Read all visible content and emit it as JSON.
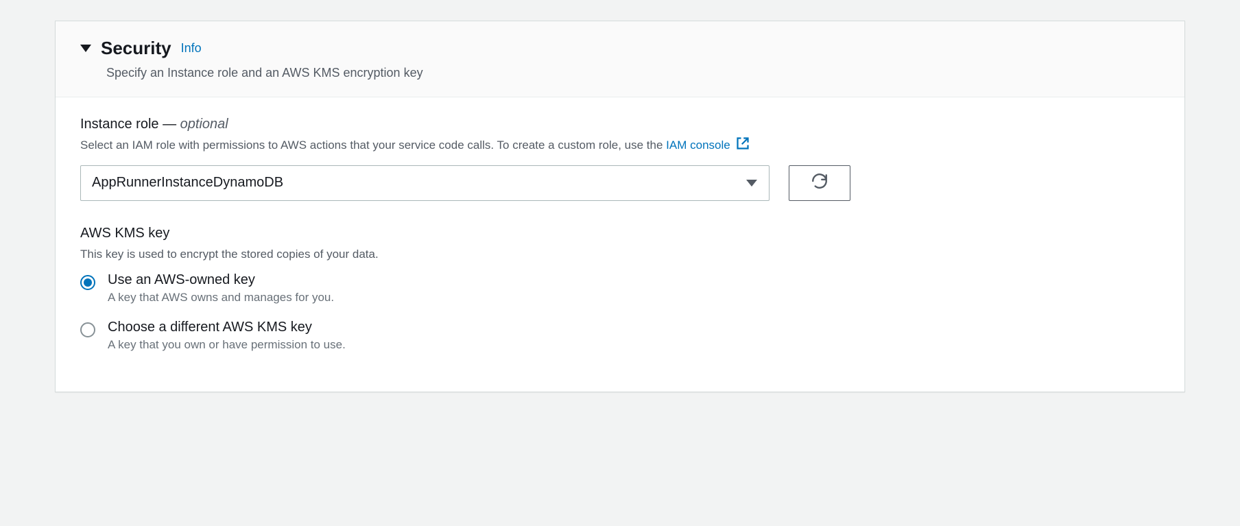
{
  "section": {
    "title": "Security",
    "info_link": "Info",
    "subtitle": "Specify an Instance role and an AWS KMS encryption key"
  },
  "instance_role": {
    "label": "Instance role",
    "optional_text": "optional",
    "help_prefix": "Select an IAM role with permissions to AWS actions that your service code calls. To create a custom role, use the ",
    "help_link": "IAM console",
    "selected_value": "AppRunnerInstanceDynamoDB"
  },
  "kms": {
    "label": "AWS KMS key",
    "help": "This key is used to encrypt the stored copies of your data.",
    "options": [
      {
        "label": "Use an AWS-owned key",
        "desc": "A key that AWS owns and manages for you.",
        "selected": true
      },
      {
        "label": "Choose a different AWS KMS key",
        "desc": "A key that you own or have permission to use.",
        "selected": false
      }
    ]
  }
}
